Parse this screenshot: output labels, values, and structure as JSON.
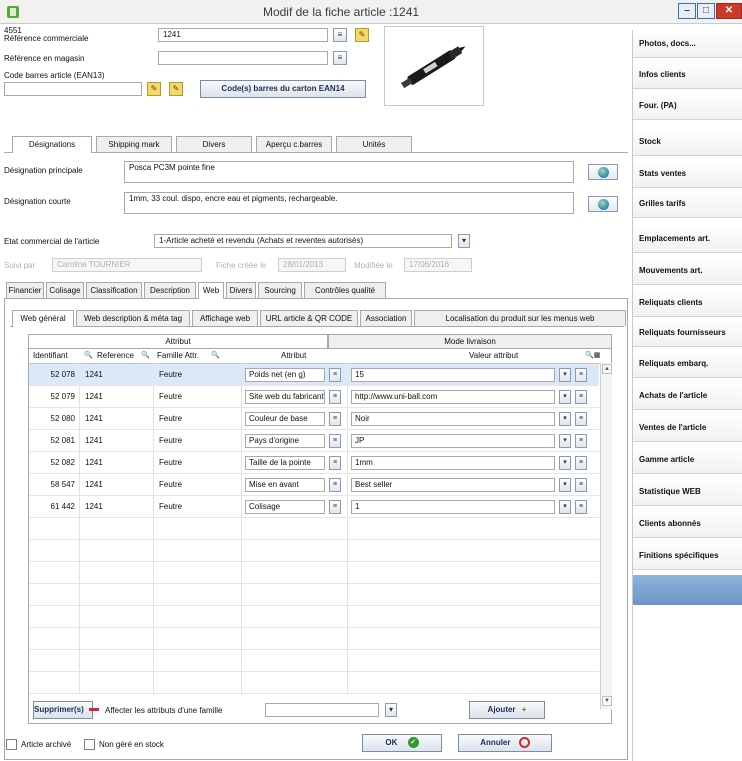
{
  "window": {
    "title": "Modif de la fiche article :1241",
    "controls": [
      "–",
      "□",
      "✕"
    ]
  },
  "header": {
    "code_top": "4551",
    "ref_label": "Référence commerciale",
    "ref_value": "1241",
    "magasin_label": "Référence en magasin",
    "magasin_value": "",
    "ean_label": "Code barres article (EAN13)",
    "ean_value": "",
    "carton_button": "Code(s) barres du carton EAN14"
  },
  "tabs1": [
    "Désignations",
    "Shipping mark",
    "Divers",
    "Aperçu c.barres",
    "Unités"
  ],
  "designation": {
    "principale_label": "Désignation principale",
    "principale_value": "Posca PC3M pointe fine",
    "courte_label": "Désignation courte",
    "courte_value": "1mm, 33 coul. dispo, encre eau et pigments, rechargeable."
  },
  "etat": {
    "label": "Etat commercial de l'article",
    "value": "1-Article acheté et revendu (Achats et reventes autorisés)"
  },
  "suivi": {
    "label": "Suivi par",
    "value": "Caroline TOURNIER",
    "cree_label": "Fiche créée le",
    "cree_value": "28/01/2013",
    "modif_label": "Modifiée le",
    "modif_value": "17/06/2016"
  },
  "tabs2": [
    "Financier",
    "Colisage",
    "Classification",
    "Description",
    "Web",
    "Divers",
    "Sourcing",
    "Contrôles qualité"
  ],
  "tabs3": [
    "Web général",
    "Web description & méta tag",
    "Affichage web",
    "URL article & QR CODE",
    "Association",
    "Localisation du produit sur les menus web"
  ],
  "subtabs": [
    "Attribut",
    "Mode livraison"
  ],
  "grid": {
    "headers": [
      "Identifiant",
      "Reference",
      "Famille Attr.",
      "Attribut",
      "Valeur attribut"
    ],
    "rows": [
      {
        "id": "52 078",
        "ref": "1241",
        "fam": "Feutre",
        "attr": "Poids net (en g)",
        "val": "15"
      },
      {
        "id": "52 079",
        "ref": "1241",
        "fam": "Feutre",
        "attr": "Site web du fabricant",
        "val": "http://www.uni-ball.com"
      },
      {
        "id": "52 080",
        "ref": "1241",
        "fam": "Feutre",
        "attr": "Couleur de base",
        "val": "Noir"
      },
      {
        "id": "52 081",
        "ref": "1241",
        "fam": "Feutre",
        "attr": "Pays d'origine",
        "val": "JP"
      },
      {
        "id": "52 082",
        "ref": "1241",
        "fam": "Feutre",
        "attr": "Taille de la pointe",
        "val": "1mm"
      },
      {
        "id": "58 547",
        "ref": "1241",
        "fam": "Feutre",
        "attr": "Mise en avant",
        "val": "Best seller"
      },
      {
        "id": "61 442",
        "ref": "1241",
        "fam": "Feutre",
        "attr": "Colisage",
        "val": "1"
      }
    ]
  },
  "grid_footer": {
    "supprimer": "Supprimer(s)",
    "affecter_label": "Affecter les attributs d'une famille",
    "affecter_value": "",
    "ajouter": "Ajouter"
  },
  "bottom": {
    "archive_label": "Article archivé",
    "stock_label": "Non géré en stock",
    "ok": "OK",
    "annuler": "Annuler"
  },
  "sidebar": [
    "Photos, docs...",
    "Infos clients",
    "Four. (PA)",
    "Stock",
    "Stats ventes",
    "Grilles tarifs",
    "Emplacements art.",
    "Mouvements art.",
    "Reliquats clients",
    "Reliquats fournisseurs",
    "Reliquats embarq.",
    "Achats de l'article",
    "Ventes de l'article",
    "Gamme article",
    "Statistique WEB",
    "Clients abonnés",
    "Finitions spécifiques"
  ],
  "colors": {
    "accent_blue": "#6a96c8",
    "selected_row": "#dbe8f8",
    "close_red": "#c93a2a",
    "ok_green": "#2e9a2e",
    "cancel_red": "#d12a2a"
  }
}
